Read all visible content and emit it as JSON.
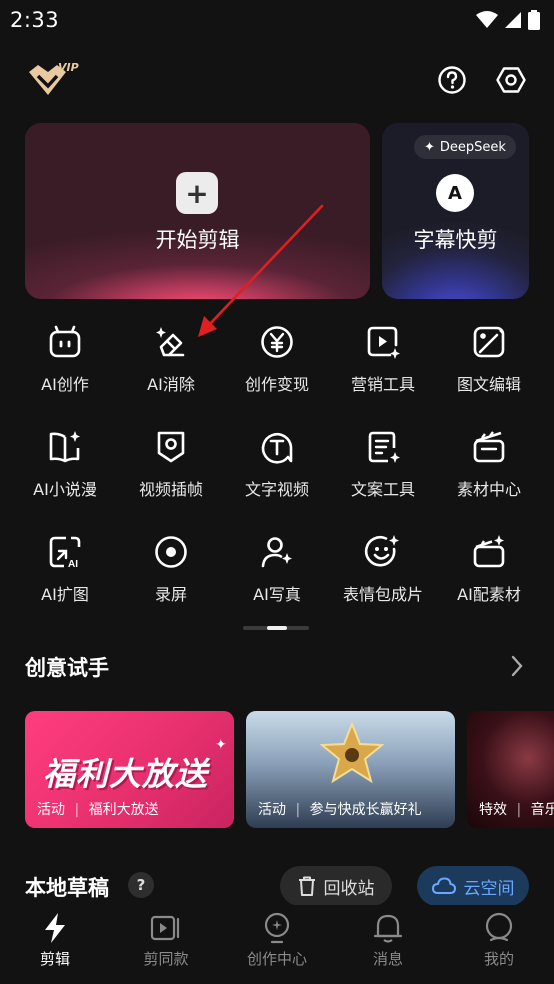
{
  "status_bar": {
    "time": "2:33",
    "icons": [
      "wifi-icon",
      "signal-icon",
      "battery-icon"
    ]
  },
  "header": {
    "vip_label": "VIP",
    "icons": [
      "help-icon",
      "settings-icon"
    ]
  },
  "main_card": {
    "title": "开始剪辑",
    "icon": "plus-icon"
  },
  "side_card": {
    "badge": "DeepSeek",
    "title": "字幕快剪",
    "icon_letter": "A"
  },
  "tools": [
    {
      "label": "AI创作",
      "icon": "ai-bot-icon"
    },
    {
      "label": "AI消除",
      "icon": "eraser-icon"
    },
    {
      "label": "创作变现",
      "icon": "yen-icon"
    },
    {
      "label": "营销工具",
      "icon": "play-sparkle-icon"
    },
    {
      "label": "图文编辑",
      "icon": "image-edit-icon"
    },
    {
      "label": "AI小说漫",
      "icon": "book-sparkle-icon"
    },
    {
      "label": "视频插帧",
      "icon": "frame-icon"
    },
    {
      "label": "文字视频",
      "icon": "text-bubble-icon"
    },
    {
      "label": "文案工具",
      "icon": "doc-sparkle-icon"
    },
    {
      "label": "素材中心",
      "icon": "clapper-icon"
    },
    {
      "label": "AI扩图",
      "icon": "expand-image-icon"
    },
    {
      "label": "录屏",
      "icon": "record-icon"
    },
    {
      "label": "AI写真",
      "icon": "portrait-sparkle-icon"
    },
    {
      "label": "表情包成片",
      "icon": "emoji-sparkle-icon"
    },
    {
      "label": "AI配素材",
      "icon": "clapper-sparkle-icon"
    }
  ],
  "creative_section": {
    "title": "创意试手"
  },
  "banners": [
    {
      "big_text": "福利大放送",
      "tag": "活动",
      "caption": "福利大放送",
      "color": "#e8306e"
    },
    {
      "tag": "活动",
      "caption": "参与快成长赢好礼",
      "color": "#8aa0b8"
    },
    {
      "tag": "特效",
      "caption": "音乐",
      "color": "#3a1018"
    }
  ],
  "drafts_section": {
    "title": "本地草稿",
    "help": "?",
    "recycle_label": "回收站",
    "cloud_label": "云空间"
  },
  "bottom_nav": [
    {
      "label": "剪辑",
      "icon": "bolt-icon",
      "active": true
    },
    {
      "label": "剪同款",
      "icon": "template-icon",
      "active": false
    },
    {
      "label": "创作中心",
      "icon": "bulb-icon",
      "active": false
    },
    {
      "label": "消息",
      "icon": "bell-icon",
      "active": false
    },
    {
      "label": "我的",
      "icon": "profile-icon",
      "active": false
    }
  ],
  "colors": {
    "accent_blue": "#6aa8ff",
    "background": "#121212",
    "annotation_arrow": "#e02020"
  }
}
